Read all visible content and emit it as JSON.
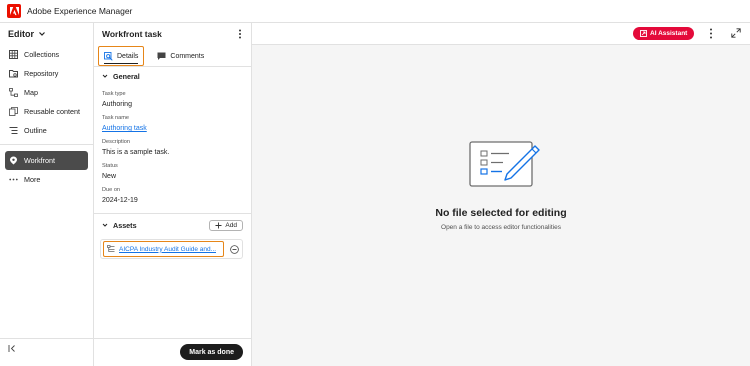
{
  "app": {
    "title": "Adobe Experience Manager"
  },
  "leftnav": {
    "selector_label": "Editor",
    "items": [
      {
        "label": "Collections",
        "icon": "collections-icon"
      },
      {
        "label": "Repository",
        "icon": "repository-icon"
      },
      {
        "label": "Map",
        "icon": "map-icon"
      },
      {
        "label": "Reusable content",
        "icon": "reusable-content-icon"
      },
      {
        "label": "Outline",
        "icon": "outline-icon"
      }
    ],
    "active_item": {
      "label": "Workfront",
      "icon": "workfront-icon"
    },
    "more_label": "More"
  },
  "panel": {
    "title": "Workfront task",
    "tabs": [
      {
        "label": "Details",
        "active": true
      },
      {
        "label": "Comments",
        "active": false
      }
    ],
    "general": {
      "heading": "General",
      "fields": [
        {
          "label": "Task type",
          "value": "Authoring"
        },
        {
          "label": "Task name",
          "value": "Authoring task"
        },
        {
          "label": "Description",
          "value": "This is a sample task."
        },
        {
          "label": "Status",
          "value": "New"
        },
        {
          "label": "Due on",
          "value": "2024-12-19"
        }
      ]
    },
    "assets": {
      "heading": "Assets",
      "add_label": "Add",
      "items": [
        {
          "name": "AICPA Industry Audit Guide and..."
        }
      ]
    },
    "mark_done_label": "Mark as done"
  },
  "main": {
    "ai_button_label": "AI Assistant",
    "empty_title": "No file selected for editing",
    "empty_subtitle": "Open a file to access editor functionalities"
  },
  "colors": {
    "accent_highlight": "#e68619",
    "ai_button": "#e40a3a",
    "brand": "#eb1000",
    "link": "#1473e6"
  }
}
